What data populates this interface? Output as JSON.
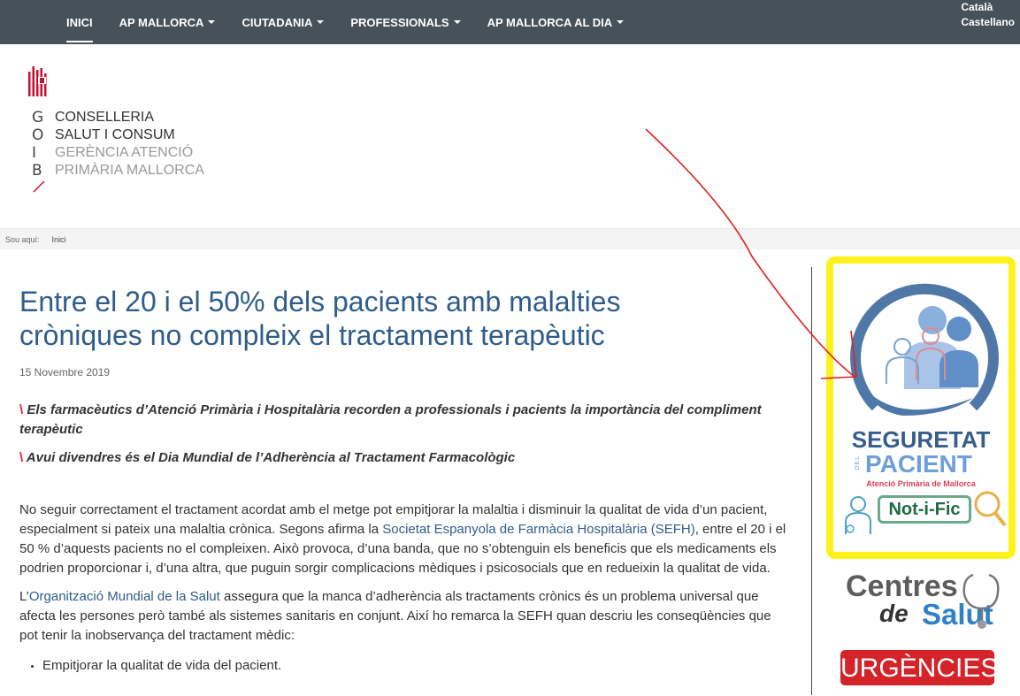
{
  "nav": {
    "items": [
      {
        "label": "INICI",
        "dropdown": false,
        "active": true
      },
      {
        "label": "AP MALLORCA",
        "dropdown": true
      },
      {
        "label": "CIUTADANIA",
        "dropdown": true
      },
      {
        "label": "PROFESSIONALS",
        "dropdown": true
      },
      {
        "label": "AP MALLORCA AL DIA",
        "dropdown": true
      }
    ],
    "languages": [
      "Català",
      "Castellano"
    ],
    "bg_color": "#46515a"
  },
  "logo": {
    "goib_letters": [
      "G",
      "O",
      "I",
      "B"
    ],
    "lines_dark": [
      "CONSELLERIA",
      "SALUT I CONSUM"
    ],
    "lines_light": [
      "GERÈNCIA ATENCIÓ",
      "PRIMÀRIA MALLORCA"
    ],
    "accent_color": "#c8102e"
  },
  "breadcrumb": {
    "prefix": "Sou aquí:",
    "items": [
      "Inici"
    ]
  },
  "article": {
    "title_line1": "Entre el 20 i el 50% dels pacients amb malalties",
    "title_line2": "cròniques no compleix el tractament terapèutic",
    "date": "15 Novembre 2019",
    "lead_marker": "\\",
    "lead1": "Els farmacèutics d’Atenció Primària i Hospitalària recorden a professionals i pacients la importància del compliment terapèutic",
    "lead2": "Avui divendres és el Dia Mundial de l’Adherència al Tractament Farmacològic",
    "p1_a": "No seguir correctament el tractament acordat amb el metge pot empitjorar la malaltia i disminuir la qualitat de vida d’un pacient, especialment si pateix una malaltia crònica. Segons afirma la ",
    "p1_link": "Societat Espanyola de Farmàcia Hospitalària (SEFH)",
    "p1_b": ", entre el 20 i el 50 % d’aquests pacients no el compleixen. Això provoca, d’una banda, que no s’obtenguin els beneficis que els medicaments els podrien proporcionar i, d’una altra, que puguin sorgir complicacions mèdiques i psicosocials que en redueixin la qualitat de vida.",
    "p2_a": "L’",
    "p2_link": "Organització Mundial de la Salut",
    "p2_b": " assegura que la manca d’adherència als tractaments crònics és un problema universal que afecta les persones però també als sistemes sanitaris en conjunt. Així ho remarca la SEFH quan descriu les conseqüències que pot tenir la inobservança del tractament mèdic:",
    "bullets": [
      "Empitjorar la qualitat de vida del pacient."
    ],
    "title_color": "#2f5d8a",
    "link_color": "#2f5d8a"
  },
  "sidebar": {
    "seguretat": {
      "line1": "SEGURETAT",
      "del": "DEL",
      "line2": "PACIENT",
      "subtitle": "Atenció Primària de Mallorca",
      "notific": "Not-i-Fic",
      "highlight_color": "#fff21a"
    },
    "centres": {
      "word1": "Centres",
      "word2": "de",
      "word3": "Salut"
    },
    "urgencies": {
      "label": "URGÈNCIES",
      "color": "#d5232a"
    }
  },
  "annotation": {
    "arrow_color": "#e0201c"
  }
}
